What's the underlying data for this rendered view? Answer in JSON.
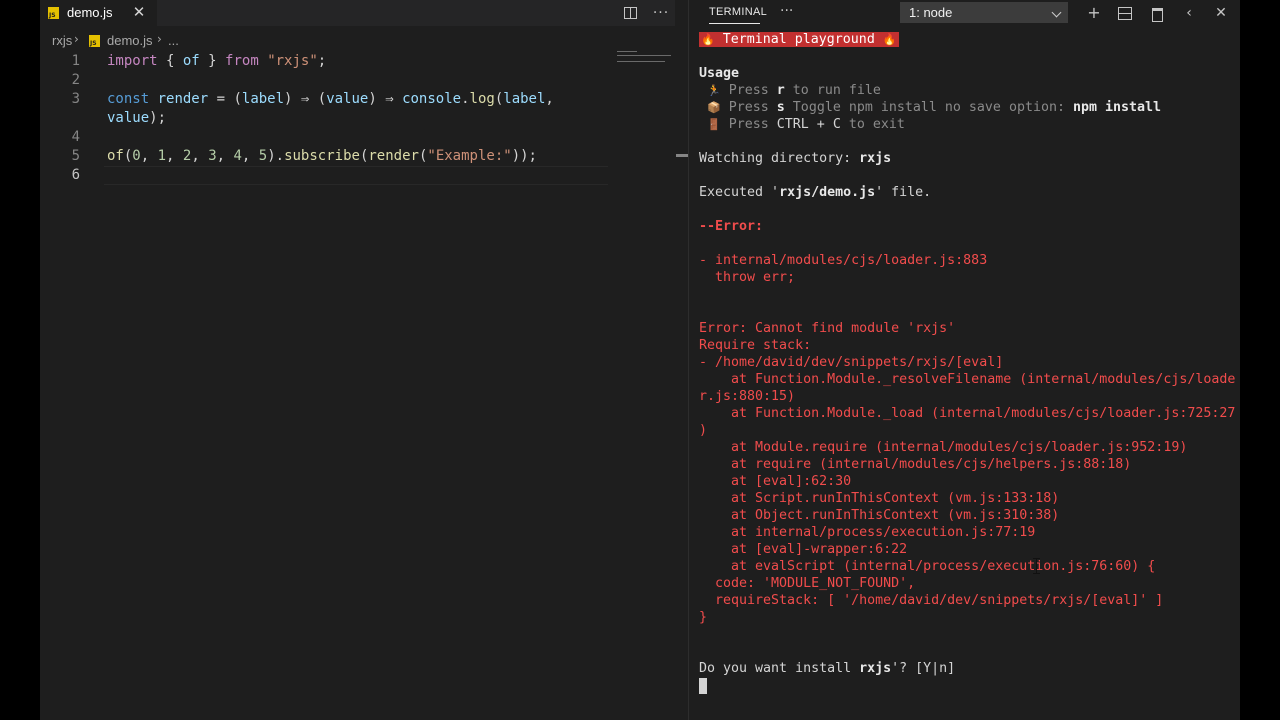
{
  "editor": {
    "tab": {
      "label": "demo.js",
      "close_glyph": "✕"
    },
    "actions": {
      "more_glyph": "···"
    },
    "breadcrumb": {
      "folder": "rxjs",
      "file": "demo.js",
      "ellipsis": "..."
    },
    "line_numbers": [
      "1",
      "2",
      "3",
      "4",
      "5",
      "6"
    ],
    "code": {
      "line1": [
        "import",
        " { ",
        "of",
        " } ",
        "from",
        " ",
        "\"rxjs\"",
        ";"
      ],
      "line3a": [
        "const",
        " ",
        "render",
        " = (",
        "label",
        ") ⇒ (",
        "value",
        ") ⇒ ",
        "console",
        ".",
        "log",
        "(",
        "label",
        ","
      ],
      "line3b": [
        "value",
        ");"
      ],
      "line5": [
        "of",
        "(",
        "0",
        ", ",
        "1",
        ", ",
        "2",
        ", ",
        "3",
        ", ",
        "4",
        ", ",
        "5",
        ").",
        "subscribe",
        "(",
        "render",
        "(",
        "\"Example:\"",
        "));"
      ]
    }
  },
  "terminal": {
    "tab_label": "TERMINAL",
    "more_glyph": "···",
    "selected_terminal": "1: node",
    "buttons": {
      "new": "+",
      "previous": "‹",
      "close": "✕"
    },
    "lines": {
      "banner": "Terminal playground",
      "usage": "Usage",
      "press1": "Press ",
      "key_r": "r",
      "run_file": " to run file",
      "press2": "Press ",
      "key_s": "s",
      "toggle": " Toggle npm install no save option: ",
      "npm_install": "npm install",
      "press3": "Press ",
      "key_ctrl": "CTRL + C",
      "to_exit": " to exit",
      "watching": "Watching directory: ",
      "watching_dir": "rxjs",
      "executed_pre": "Executed '",
      "executed_file": "rxjs/demo.js",
      "executed_post": "' file.",
      "error_header": "--Error:",
      "err1": "- internal/modules/cjs/loader.js:883",
      "err2": "  throw err;",
      "err3": "Error: Cannot find module 'rxjs'",
      "err4": "Require stack:",
      "err5": "- /home/david/dev/snippets/rxjs/[eval]",
      "err6": "    at Function.Module._resolveFilename (internal/modules/cjs/loade",
      "err7": "r.js:880:15)",
      "err8": "    at Function.Module._load (internal/modules/cjs/loader.js:725:27",
      "err9": ")",
      "err10": "    at Module.require (internal/modules/cjs/loader.js:952:19)",
      "err11": "    at require (internal/modules/cjs/helpers.js:88:18)",
      "err12": "    at [eval]:62:30",
      "err13": "    at Script.runInThisContext (vm.js:133:18)",
      "err14": "    at Object.runInThisContext (vm.js:310:38)",
      "err15": "    at internal/process/execution.js:77:19",
      "err16": "    at [eval]-wrapper:6:22",
      "err17": "    at evalScript (internal/process/execution.js:76:60) {",
      "err18": "  code: 'MODULE_NOT_FOUND',",
      "err19": "  requireStack: [ '/home/david/dev/snippets/rxjs/[eval]' ]",
      "err20": "}",
      "prompt_pre": "Do you want install ",
      "prompt_pkg": "rxjs",
      "prompt_post": "'? [Y|n]"
    }
  },
  "colors": {
    "editor_bg": "#1e1e1e",
    "error_red": "#f14c4c",
    "banner_bg": "#c23030"
  }
}
